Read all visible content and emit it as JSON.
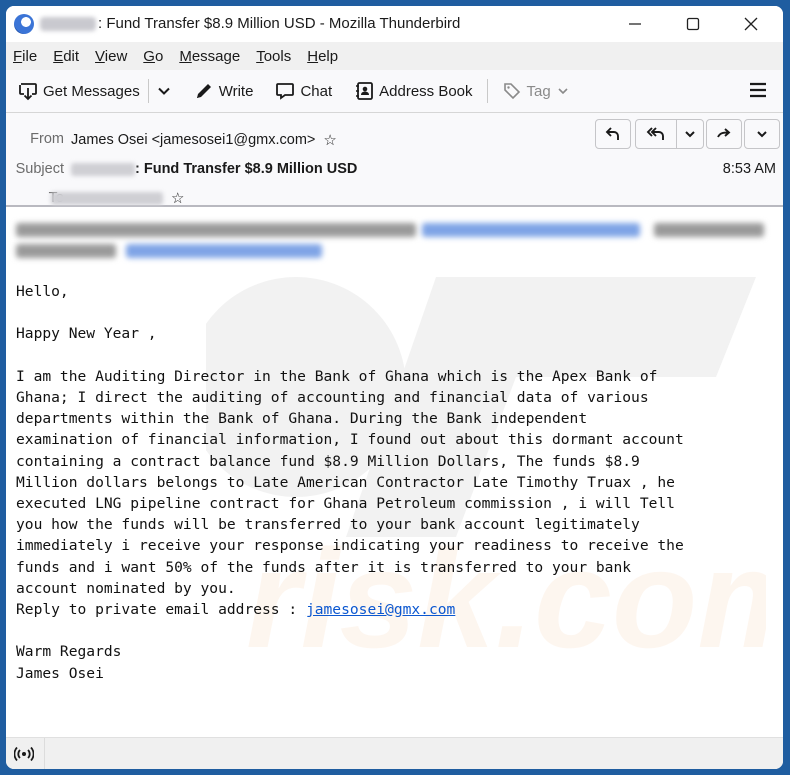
{
  "window": {
    "title": ": Fund Transfer $8.9 Million USD - Mozilla Thunderbird",
    "title_prefix_redacted": true,
    "controls": {
      "minimize": "—",
      "maximize": "☐",
      "close": "✕"
    }
  },
  "menubar": {
    "items": [
      {
        "label": "File",
        "accel": "F",
        "rest": "ile"
      },
      {
        "label": "Edit",
        "accel": "E",
        "rest": "dit"
      },
      {
        "label": "View",
        "accel": "V",
        "rest": "iew"
      },
      {
        "label": "Go",
        "accel": "G",
        "rest": "o"
      },
      {
        "label": "Message",
        "accel": "M",
        "rest": "essage"
      },
      {
        "label": "Tools",
        "accel": "T",
        "rest": "ools"
      },
      {
        "label": "Help",
        "accel": "H",
        "rest": "elp"
      }
    ]
  },
  "toolbar": {
    "get_messages": "Get Messages",
    "write": "Write",
    "chat": "Chat",
    "address_book": "Address Book",
    "tag": "Tag"
  },
  "header": {
    "from_label": "From",
    "from_value": "James Osei <jamesosei1@gmx.com>",
    "subject_label": "Subject",
    "subject_value": ": Fund Transfer $8.9 Million USD",
    "subject_prefix_redacted": true,
    "to_label": "To",
    "to_value_redacted": true,
    "date": "8:53 AM",
    "actions": [
      "reply",
      "reply-all",
      "reply-all-dropdown",
      "forward",
      "more"
    ]
  },
  "message": {
    "blurred_preface": "[redacted / blurred forwarding notice with link]",
    "greeting": "Hello,",
    "new_year": "Happy New Year ,",
    "paragraph": "I am the Auditing Director in the Bank of Ghana which is the Apex Bank of\nGhana; I direct the auditing of accounting and financial data of various\ndepartments within the Bank of Ghana. During the Bank independent\nexamination of financial information, I found out about this dormant account\ncontaining a contract balance fund $8.9 Million Dollars, The funds $8.9\nMillion dollars belongs to Late American Contractor Late Timothy Truax , he\nexecuted LNG pipeline contract for Ghana Petroleum commission , i will Tell\nyou how the funds will be transferred to your bank account legitimately\nimmediately i receive your response indicating your readiness to receive the\nfunds and i want 50% of the funds after it is transferred to your bank\naccount nominated by you.",
    "reply_prefix": "Reply to private email address : ",
    "reply_email": "jamesosei@gmx.com",
    "closing": "Warm Regards",
    "signature": "James Osei"
  },
  "statusbar": {
    "icon": "online-status-icon"
  },
  "colors": {
    "frame": "#1f5da0",
    "link": "#0b57d0",
    "menubar_bg": "#f0f0f0",
    "toolbar_bg": "#f9f9fb"
  }
}
